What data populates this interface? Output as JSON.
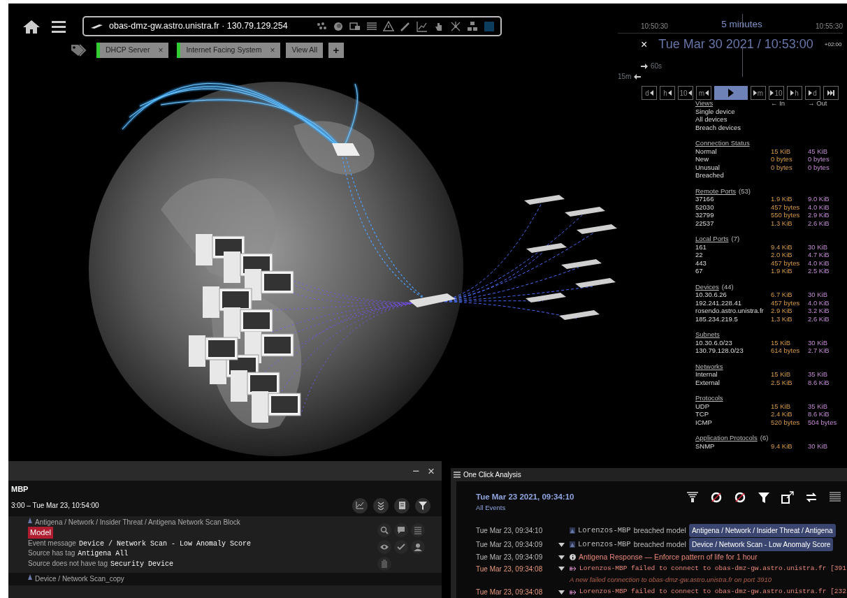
{
  "device_bar": {
    "device": "obas-dmz-gw.astro.unistra.fr · 130.79.129.254"
  },
  "tags": [
    {
      "label": "DHCP Server",
      "remove": "×"
    },
    {
      "label": "Internet Facing System",
      "remove": "×"
    }
  ],
  "view_all": "View All",
  "add_tag": "+",
  "timeline": {
    "start": "10:50:30",
    "span": "5 minutes",
    "end": "10:55:30",
    "close": "×",
    "current": "Tue Mar 30 2021 / 10:53:00",
    "timezone": "+02:00",
    "step": "60s",
    "window": "15m",
    "buttons": [
      {
        "kind": "back",
        "label": "d",
        "selected": false
      },
      {
        "kind": "back",
        "label": "h",
        "selected": false
      },
      {
        "kind": "back",
        "label": "10",
        "selected": false
      },
      {
        "kind": "back",
        "label": "m",
        "selected": false
      },
      {
        "kind": "play",
        "selected": true
      },
      {
        "kind": "forward",
        "label": "m",
        "selected": false
      },
      {
        "kind": "forward",
        "label": "10",
        "selected": false
      },
      {
        "kind": "forward",
        "label": "h",
        "selected": false
      },
      {
        "kind": "forward",
        "label": "d",
        "selected": false
      },
      {
        "kind": "end",
        "selected": false
      }
    ]
  },
  "stats": {
    "views": {
      "title": "Views",
      "in": "← In",
      "out": "→ Out",
      "items": [
        "Single device",
        "All devices",
        "Breach devices"
      ]
    },
    "sections": [
      {
        "title": "Connection Status",
        "rows": [
          {
            "label": "Normal",
            "in": "15 KiB",
            "out": "45 KiB"
          },
          {
            "label": "New",
            "in": "0 bytes",
            "out": "0 bytes"
          },
          {
            "label": "Unusual",
            "in": "0 bytes",
            "out": "0 bytes"
          },
          {
            "label": "Breached"
          }
        ]
      },
      {
        "title": "Remote Ports",
        "count": "(53)",
        "rows": [
          {
            "label": "37166",
            "in": "1.9 KiB",
            "out": "9.0 KiB"
          },
          {
            "label": "52030",
            "in": "457 bytes",
            "out": "4.0 KiB"
          },
          {
            "label": "32799",
            "in": "550 bytes",
            "out": "2.9 KiB"
          },
          {
            "label": "22537",
            "in": "1.3 KiB",
            "out": "2.6 KiB"
          }
        ]
      },
      {
        "title": "Local Ports",
        "count": "(7)",
        "rows": [
          {
            "label": "161",
            "in": "9.4 KiB",
            "out": "30 KiB"
          },
          {
            "label": "22",
            "in": "2.0 KiB",
            "out": "4.7 KiB"
          },
          {
            "label": "443",
            "in": "457 bytes",
            "out": "4.0 KiB"
          },
          {
            "label": "67",
            "in": "1.9 KiB",
            "out": "2.5 KiB"
          }
        ]
      },
      {
        "title": "Devices",
        "count": "(44)",
        "rows": [
          {
            "label": "10.30.6.26",
            "in": "6.7 KiB",
            "out": "30 KiB"
          },
          {
            "label": "192.241.228.41",
            "in": "457 bytes",
            "out": "4.0 KiB"
          },
          {
            "label": "rosendo.astro.unistra.fr",
            "in": "2.9 KiB",
            "out": "3.2 KiB"
          },
          {
            "label": "185.234.219.5",
            "in": "1.3 KiB",
            "out": "2.6 KiB"
          }
        ]
      },
      {
        "title": "Subnets",
        "rows": [
          {
            "label": "10.30.6.0/23",
            "in": "15 KiB",
            "out": "30 KiB"
          },
          {
            "label": "130.79.128.0/23",
            "in": "614 bytes",
            "out": "2.7 KiB"
          }
        ]
      },
      {
        "title": "Networks",
        "rows": [
          {
            "label": "Internal",
            "in": "15 KiB",
            "out": "35 KiB"
          },
          {
            "label": "External",
            "in": "2.5 KiB",
            "out": "8.6 KiB"
          }
        ]
      },
      {
        "title": "Protocols",
        "rows": [
          {
            "label": "UDP",
            "in": "15 KiB",
            "out": "35 KiB"
          },
          {
            "label": "TCP",
            "in": "2.4 KiB",
            "out": "8.6 KiB"
          },
          {
            "label": "ICMP",
            "in": "520 bytes",
            "out": "504 bytes"
          }
        ]
      },
      {
        "title": "Application Protocols",
        "count": "(6)",
        "rows": [
          {
            "label": "SNMP",
            "in": "9.4 KiB",
            "out": "30 KiB"
          }
        ]
      }
    ]
  },
  "breach_panel": {
    "minimize": "−",
    "close": "×",
    "device": "MBP",
    "range": "3:00 – Tue Mar 23, 10:54:00",
    "events": [
      {
        "path": "Antigena / Network / Insider Threat / Antigena Network Scan Block",
        "badge": "Model",
        "lines": [
          {
            "label": "Event message",
            "value": "Device / Network Scan - Low Anomaly Score"
          },
          {
            "label": "Source has tag",
            "value": "Antigena All"
          },
          {
            "label": "Source does not have tag",
            "value": "Security Device"
          }
        ]
      },
      {
        "path": "Device / Network Scan_copy"
      }
    ]
  },
  "analysis": {
    "title": "One Click Analysis",
    "date": "Tue Mar 23 2021, 09:34:10",
    "filter": "All Events",
    "events": [
      {
        "kind": "breach",
        "time": "Tue Mar 23, 09:34:10",
        "expandable": false,
        "device": "Lorenzos-MBP",
        "verb": "breached model",
        "model": "Antigena / Network / Insider Threat / Antigena"
      },
      {
        "kind": "breach",
        "time": "Tue Mar 23, 09:34:09",
        "expandable": true,
        "device": "Lorenzos-MBP",
        "verb": "breached model",
        "model": "Device / Network Scan - Low Anomaly Score"
      },
      {
        "kind": "response",
        "time": "Tue Mar 23, 09:34:09",
        "expandable": true,
        "text": "Antigena Response — Enforce pattern of life for 1 hour"
      },
      {
        "kind": "failed",
        "time": "Tue Mar 23, 09:34:08",
        "expandable": true,
        "text": "Lorenzos-MBP failed to connect to obas-dmz-gw.astro.unistra.fr [391",
        "detail": "A new failed connection to obas-dmz-gw.astro.unistra.fr on port 3910"
      },
      {
        "kind": "failed",
        "time": "Tue Mar 23, 09:34:08",
        "expandable": true,
        "text": "Lorenzos-MBP failed to connect to obas-dmz-gw.astro.unistra.fr [232"
      }
    ]
  }
}
